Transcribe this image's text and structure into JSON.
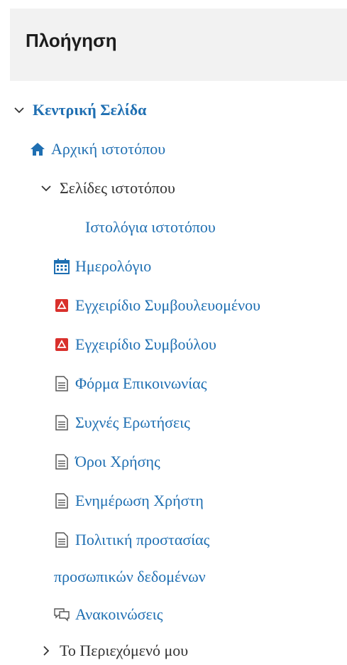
{
  "panel": {
    "title": "Πλοήγηση"
  },
  "nav": {
    "root_label": "Κεντρική Σελίδα",
    "site_home": "Αρχική ιστοτόπου",
    "site_pages": "Σελίδες ιστοτόπου",
    "site_blogs": "Ιστολόγια ιστοτόπου",
    "calendar": "Ημερολόγιο",
    "manual_mentee": "Εγχειρίδιο Συμβουλευομένου",
    "manual_mentor": "Εγχειρίδιο Συμβούλου",
    "contact_form": "Φόρμα Επικοινωνίας",
    "faq": "Συχνές Ερωτήσεις",
    "terms": "Όροι Χρήσης",
    "user_update": "Ενημέρωση Χρήστη",
    "privacy_line1": "Πολιτική προστασίας",
    "privacy_line2": "προσωπικών δεδομένων",
    "announcements": "Ανακοινώσεις",
    "my_content": "Το Περιεχόμενό μου"
  },
  "colors": {
    "link": "#1f6fb2",
    "text_dark": "#333333",
    "header_bg": "#f2f2f2",
    "pdf_red": "#d9302c"
  }
}
